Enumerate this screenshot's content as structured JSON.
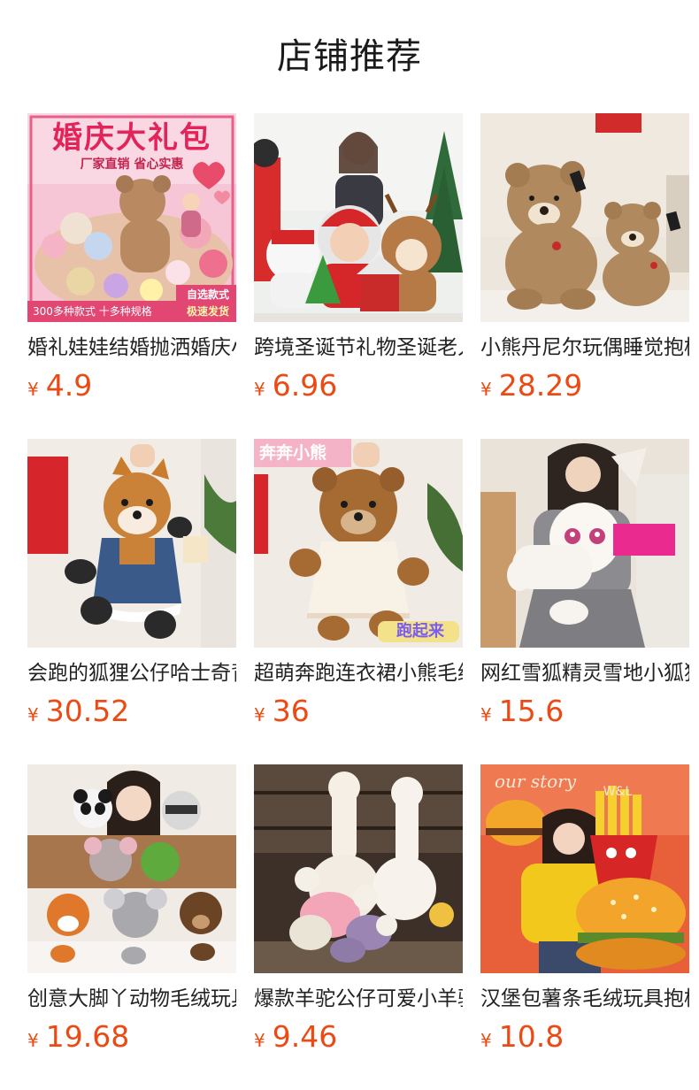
{
  "shop": {
    "title": "店铺推荐"
  },
  "currency_symbol": "¥",
  "products": [
    {
      "name": "婚礼娃娃结婚抛洒婚庆小礼品公仔",
      "price": "4.9",
      "badge_title": "婚庆大礼包",
      "badge_subtitle": "厂家直销 省心实惠",
      "badge_corner": "自选款式",
      "badge_bottom_left": "300多种款式 十多种规格",
      "badge_bottom_right": "极速发货"
    },
    {
      "name": "跨境圣诞节礼物圣诞老人雪人麋鹿公仔",
      "price": "6.96"
    },
    {
      "name": "小熊丹尼尔玩偶睡觉抱枕泰迪熊",
      "price": "28.29"
    },
    {
      "name": "会跑的狐狸公仔哈士奇背带裤玩偶",
      "price": "30.52"
    },
    {
      "name": "超萌奔跑连衣裙小熊毛绒玩具",
      "price": "36",
      "badge_top": "奔奔小熊",
      "badge_bottom": "跑起来"
    },
    {
      "name": "网红雪狐精灵雪地小狐狸玩偶",
      "price": "15.6"
    },
    {
      "name": "创意大脚丫动物毛绒玩具公仔",
      "price": "19.68"
    },
    {
      "name": "爆款羊驼公仔可爱小羊驼玩偶",
      "price": "9.46"
    },
    {
      "name": "汉堡包薯条毛绒玩具抱枕",
      "price": "10.8",
      "badge_top": "our story",
      "badge_logo": "W&L"
    }
  ],
  "colors": {
    "price": "#ec4a14",
    "title": "#1a1a1a"
  }
}
